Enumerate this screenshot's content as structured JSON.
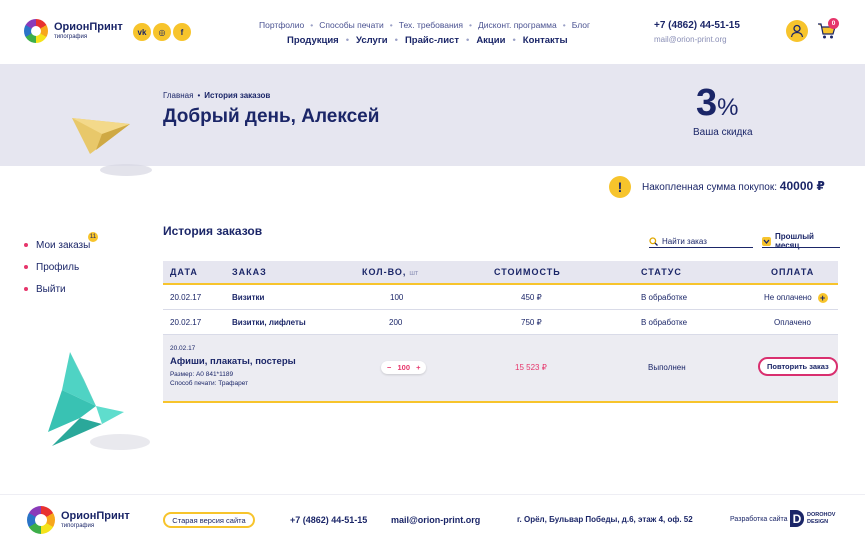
{
  "header": {
    "logo_name": "ОрионПринт",
    "logo_sub": "типография",
    "social": [
      {
        "icon": "vk-icon",
        "label": "vk"
      },
      {
        "icon": "instagram-icon",
        "label": "◎"
      },
      {
        "icon": "facebook-icon",
        "label": "f"
      }
    ],
    "top_nav": [
      "Портфолио",
      "Способы печати",
      "Тех. требования",
      "Дисконт. программа",
      "Блог"
    ],
    "main_nav": [
      "Продукция",
      "Услуги",
      "Прайс-лист",
      "Акции",
      "Контакты"
    ],
    "phone": "+7 (4862) 44-51-15",
    "email": "mail@orion-print.org",
    "cart_count": "0"
  },
  "hero": {
    "breadcrumb_home": "Главная",
    "breadcrumb_sep": "•",
    "breadcrumb_current": "История заказов",
    "greeting": "Добрый день, Алексей",
    "discount_value": "3",
    "discount_unit": "%",
    "discount_label": "Ваша скидка"
  },
  "accumulated": {
    "icon_glyph": "!",
    "label": "Накопленная сумма покупок:",
    "value": "40000 ₽"
  },
  "sidebar": {
    "items": [
      {
        "label": "Мои заказы",
        "badge": "11"
      },
      {
        "label": "Профиль"
      },
      {
        "label": "Выйти"
      }
    ]
  },
  "orders": {
    "title": "История заказов",
    "search_placeholder": "Найти заказ",
    "period_label": "Прошлый месяц",
    "columns": {
      "date": "ДАТА",
      "order": "ЗАКАЗ",
      "qty": "КОЛ-ВО,",
      "qty_unit": "шт",
      "cost": "СТОИМОСТЬ",
      "status": "СТАТУС",
      "payment": "ОПЛАТА"
    },
    "rows": [
      {
        "date": "20.02.17",
        "order": "Визитки",
        "qty": "100",
        "cost": "450 ₽",
        "status": "В обработке",
        "payment": "Не оплачено",
        "plus": "+"
      },
      {
        "date": "20.02.17",
        "order": "Визитки, лифлеты",
        "qty": "200",
        "cost": "750 ₽",
        "status": "В обработке",
        "payment": "Оплачено"
      }
    ],
    "expanded_row": {
      "date": "20.02.17",
      "order": "Афиши, плакаты, постеры",
      "size": "Размер: А0 841*1189",
      "method": "Способ печати: Трафарет",
      "qty_minus": "−",
      "qty": "100",
      "qty_plus": "+",
      "cost": "15 523 ₽",
      "status": "Выполнен",
      "repeat_label": "Повторить заказ"
    }
  },
  "footer": {
    "logo_name": "ОрионПринт",
    "logo_sub": "типография",
    "old_version": "Старая версия сайта",
    "phone": "+7 (4862) 44-51-15",
    "email": "mail@orion-print.org",
    "address": "г. Орёл, Бульвар Победы, д.6, этаж 4, оф. 52",
    "dev_label": "Разработка сайта",
    "dev_name_1": "DOROHOV",
    "dev_name_2": "DESIGN",
    "dev_mark": "D"
  },
  "colors": {
    "navy": "#1b2668",
    "yellow": "#f7c42c",
    "pink": "#e6356b",
    "band": "#e6e6f0"
  }
}
